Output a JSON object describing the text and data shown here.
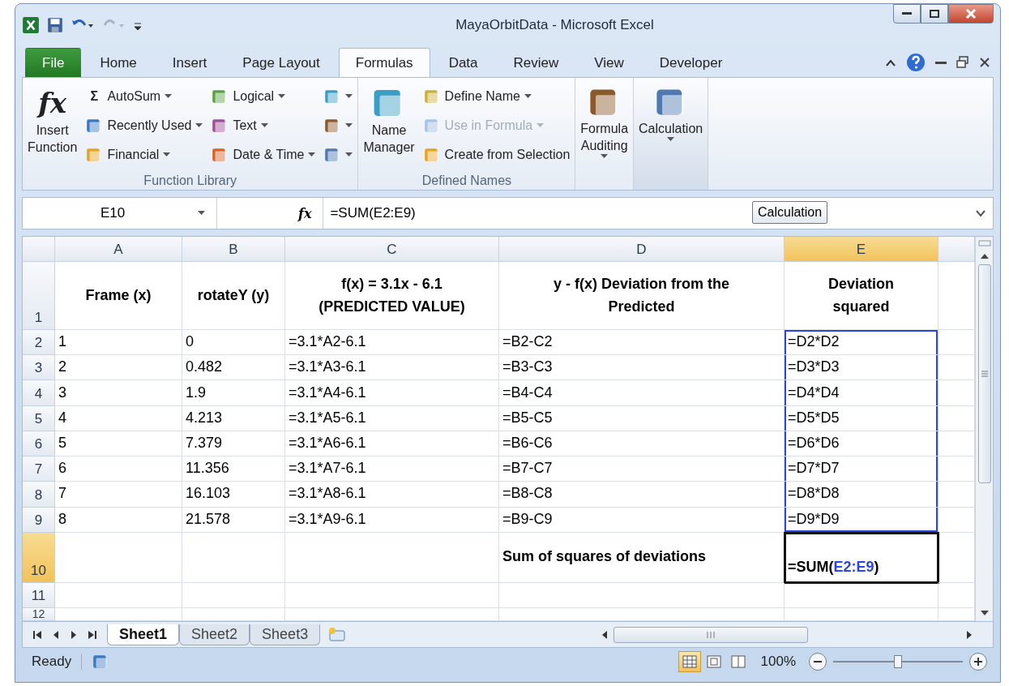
{
  "window": {
    "title": "MayaOrbitData  -  Microsoft Excel"
  },
  "ribbon_tabs": [
    {
      "label": "File",
      "kind": "file",
      "selected": false
    },
    {
      "label": "Home",
      "kind": "tab",
      "selected": false
    },
    {
      "label": "Insert",
      "kind": "tab",
      "selected": false
    },
    {
      "label": "Page Layout",
      "kind": "tab",
      "selected": false
    },
    {
      "label": "Formulas",
      "kind": "tab",
      "selected": true
    },
    {
      "label": "Data",
      "kind": "tab",
      "selected": false
    },
    {
      "label": "Review",
      "kind": "tab",
      "selected": false
    },
    {
      "label": "View",
      "kind": "tab",
      "selected": false
    },
    {
      "label": "Developer",
      "kind": "tab",
      "selected": false
    }
  ],
  "ribbon_groups": [
    {
      "label": "Function Library",
      "big": {
        "label_lines": [
          "Insert",
          "Function"
        ],
        "symbol": "fx",
        "dropdown": false
      },
      "columns": [
        [
          {
            "label": "AutoSum",
            "symbol": "Σ",
            "dropdown": true,
            "disabled": false
          },
          {
            "label": "Recently Used",
            "dropdown": true,
            "disabled": false
          },
          {
            "label": "Financial",
            "dropdown": true,
            "disabled": false
          }
        ],
        [
          {
            "label": "Logical",
            "dropdown": true,
            "disabled": false
          },
          {
            "label": "Text",
            "dropdown": true,
            "disabled": false
          },
          {
            "label": "Date & Time",
            "dropdown": true,
            "disabled": false
          }
        ],
        [
          {
            "dropdown": true,
            "disabled": false
          },
          {
            "dropdown": true,
            "disabled": false
          },
          {
            "dropdown": true,
            "disabled": false
          }
        ]
      ]
    },
    {
      "label": "Defined Names",
      "big": {
        "label_lines": [
          "Name",
          "Manager"
        ],
        "dropdown": false
      },
      "columns": [
        [
          {
            "label": "Define Name",
            "dropdown": true,
            "disabled": false
          },
          {
            "label": "Use in Formula",
            "dropdown": true,
            "disabled": true
          },
          {
            "label": "Create from Selection",
            "dropdown": false,
            "disabled": false
          }
        ]
      ]
    },
    {
      "big": {
        "label_lines": [
          "Formula",
          "Auditing"
        ],
        "dropdown": true
      }
    },
    {
      "big": {
        "label_lines": [
          "Calculation"
        ],
        "dropdown": true
      },
      "pressed": true
    }
  ],
  "formula_bar": {
    "name_box": "E10",
    "fx": "fx",
    "formula": "=SUM(E2:E9)"
  },
  "tooltip": {
    "text": "Calculation"
  },
  "sheet": {
    "columns": [
      {
        "label": "A",
        "selected": false,
        "referenced": false
      },
      {
        "label": "B",
        "selected": false,
        "referenced": false
      },
      {
        "label": "C",
        "selected": false,
        "referenced": false
      },
      {
        "label": "D",
        "selected": false,
        "referenced": false
      },
      {
        "label": "E",
        "selected": true,
        "referenced": true
      }
    ],
    "rows": [
      {
        "label": "1",
        "kind": "header",
        "selected": false,
        "referenced": false,
        "cells": [
          "Frame (x)",
          "rotateY (y)",
          "f(x) = 3.1x - 6.1\n(PREDICTED VALUE)",
          "y - f(x) Deviation from the\nPredicted",
          "Deviation\nsquared"
        ]
      },
      {
        "label": "2",
        "kind": "data",
        "selected": false,
        "referenced": true,
        "cells": [
          "1",
          "0",
          "=3.1*A2-6.1",
          "=B2-C2",
          "=D2*D2"
        ]
      },
      {
        "label": "3",
        "kind": "data",
        "selected": false,
        "referenced": true,
        "cells": [
          "2",
          "0.482",
          "=3.1*A3-6.1",
          "=B3-C3",
          "=D3*D3"
        ]
      },
      {
        "label": "4",
        "kind": "data",
        "selected": false,
        "referenced": true,
        "cells": [
          "3",
          "1.9",
          "=3.1*A4-6.1",
          "=B4-C4",
          "=D4*D4"
        ]
      },
      {
        "label": "5",
        "kind": "data",
        "selected": false,
        "referenced": true,
        "cells": [
          "4",
          "4.213",
          "=3.1*A5-6.1",
          "=B5-C5",
          "=D5*D5"
        ]
      },
      {
        "label": "6",
        "kind": "data",
        "selected": false,
        "referenced": true,
        "cells": [
          "5",
          "7.379",
          "=3.1*A6-6.1",
          "=B6-C6",
          "=D6*D6"
        ]
      },
      {
        "label": "7",
        "kind": "data",
        "selected": false,
        "referenced": true,
        "cells": [
          "6",
          "11.356",
          "=3.1*A7-6.1",
          "=B7-C7",
          "=D7*D7"
        ]
      },
      {
        "label": "8",
        "kind": "data",
        "selected": false,
        "referenced": true,
        "cells": [
          "7",
          "16.103",
          "=3.1*A8-6.1",
          "=B8-C8",
          "=D8*D8"
        ]
      },
      {
        "label": "9",
        "kind": "data",
        "selected": false,
        "referenced": true,
        "cells": [
          "8",
          "21.578",
          "=3.1*A9-6.1",
          "=B9-C9",
          "=D9*D9"
        ]
      },
      {
        "label": "10",
        "kind": "total",
        "selected": true,
        "referenced": false,
        "cells": [
          "",
          "",
          "",
          "Sum of squares of deviations",
          {
            "parts": [
              {
                "text": "=SUM(",
                "ref": false
              },
              {
                "text": "E2:E9",
                "ref": true
              },
              {
                "text": ")",
                "ref": false
              }
            ]
          }
        ]
      },
      {
        "label": "11",
        "kind": "data",
        "selected": false,
        "referenced": false,
        "cells": [
          "",
          "",
          "",
          "",
          ""
        ]
      },
      {
        "label": "12",
        "kind": "cut",
        "selected": false,
        "referenced": false,
        "cells": [
          "",
          "",
          "",
          "",
          ""
        ]
      }
    ]
  },
  "sheet_tabs": [
    {
      "label": "Sheet1",
      "selected": true
    },
    {
      "label": "Sheet2",
      "selected": false
    },
    {
      "label": "Sheet3",
      "selected": false
    }
  ],
  "status_bar": {
    "status": "Ready",
    "views": [
      {
        "selected": true
      },
      {
        "selected": false
      },
      {
        "selected": false
      }
    ],
    "zoom": "100%",
    "zoom_slider": {
      "level": 0.5
    }
  }
}
